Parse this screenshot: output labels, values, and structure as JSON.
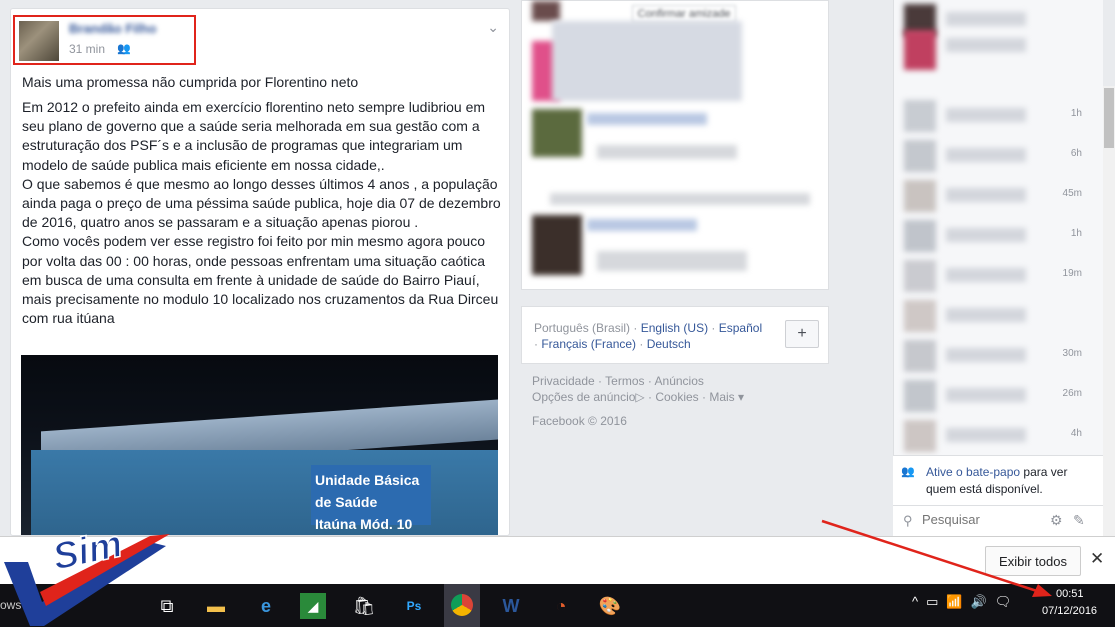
{
  "post": {
    "author": "Brandão Filho",
    "time": "31 min",
    "audience_icon": "friends-icon",
    "title": "Mais uma promessa não cumprida por Florentino neto",
    "body": "Em 2012 o prefeito ainda em exercício florentino neto sempre ludibriou em seu plano de governo que a saúde seria melhorada em sua gestão com a estruturação dos PSF´s e a inclusão de programas que integrariam um modelo de saúde publica mais eficiente em nossa cidade,.\nO que sabemos é que mesmo ao longo desses últimos 4 anos , a população ainda paga o preço de uma péssima saúde publica, hoje dia 07 de dezembro de 2016, quatro anos se passaram e a situação apenas piorou .\nComo vocês podem ver esse registro foi feito por min mesmo agora pouco por volta das 00 : 00 horas, onde pessoas enfrentam uma situação caótica em busca de uma consulta em frente à unidade de saúde do Bairro Piauí, mais precisamente no modulo 10 localizado nos cruzamentos da Rua Dirceu com rua itúana",
    "photo_sign": "Unidade Básica de Saúde",
    "photo_sign_sub": "Itaúna Mód. 10"
  },
  "suggestions": {
    "confirm_button": "Confirmar amizade"
  },
  "languages": {
    "current": "Português (Brasil)",
    "sep": " · ",
    "options": [
      "English (US)",
      "Español",
      "Français (France)",
      "Deutsch"
    ],
    "add_label": "+"
  },
  "footer": {
    "links_row1": [
      "Privacidade",
      "Termos",
      "Anúncios"
    ],
    "links_row2": [
      "Opções de anúncio",
      "Cookies",
      "Mais ▾"
    ],
    "copyright": "Facebook © 2016"
  },
  "chat": {
    "times": [
      "1h",
      "6h",
      "45m",
      "1h",
      "19m",
      "",
      "30m",
      "26m",
      "4h"
    ],
    "cta_link": "Ative o bate-papo",
    "cta_rest": " para ver quem está disponível.",
    "search_placeholder": "Pesquisar"
  },
  "download_bar": {
    "show_all": "Exibir todos",
    "close": "✕"
  },
  "taskbar": {
    "left_label": "ows",
    "time": "00:51",
    "date": "07/12/2016"
  },
  "logo_text": "Sim",
  "colors": {
    "fb_link": "#365899",
    "highlight_red": "#e0241b",
    "logo_blue": "#1f3f9a",
    "logo_red": "#e0241b"
  }
}
